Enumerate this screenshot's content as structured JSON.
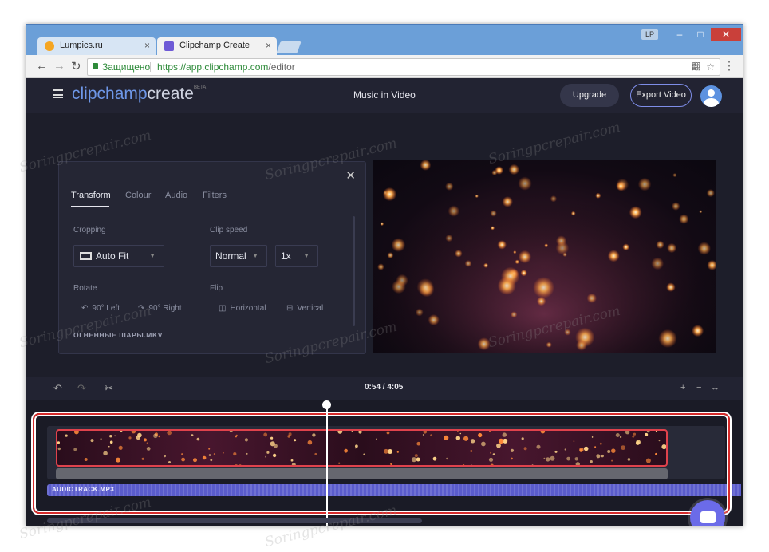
{
  "browser": {
    "tabs": [
      {
        "label": "Lumpics.ru",
        "favicon_color": "#f5a623"
      },
      {
        "label": "Clipchamp Create",
        "favicon_color": "#6e5ad6"
      }
    ],
    "profile_badge": "LP",
    "window_buttons": [
      "–",
      "□",
      "✕"
    ],
    "security_label": "Защищено",
    "url_base": "https://app.clipchamp.com",
    "url_path": "/editor",
    "translate_icon": "翻",
    "star_icon": "☆",
    "menu_icon": "⋮",
    "nav": {
      "back": "←",
      "forward": "→",
      "reload": "↻"
    }
  },
  "header": {
    "logo_part1": "clipchamp",
    "logo_part2": "create",
    "logo_badge": "BETA",
    "project_title": "Music in Video",
    "upgrade_label": "Upgrade",
    "export_label": "Export Video"
  },
  "panel": {
    "close_icon": "✕",
    "tabs": [
      "Transform",
      "Colour",
      "Audio",
      "Filters"
    ],
    "active_tab": "Transform",
    "cropping_label": "Cropping",
    "cropping_value": "Auto Fit",
    "clip_speed_label": "Clip speed",
    "speed_mode": "Normal",
    "speed_value": "1x",
    "rotate_label": "Rotate",
    "rotate_left": "90° Left",
    "rotate_right": "90° Right",
    "flip_label": "Flip",
    "flip_horizontal": "Horizontal",
    "flip_vertical": "Vertical",
    "file_name": "ОГНЕННЫЕ ШАРЫ.MKV",
    "caret": "▼"
  },
  "timeline": {
    "undo_icon": "↶",
    "redo_icon": "↷",
    "split_icon": "✂",
    "timecode": "0:54 / 4:05",
    "zoom_in_icon": "+",
    "zoom_out_icon": "−",
    "fit_icon": "↔",
    "audio_track_label": "AUDIOTRACK.MP3",
    "playhead_position_fraction": 0.22
  },
  "colors": {
    "app_bg": "#1d1e2a",
    "accent": "#6e97e8",
    "export_border": "#7e8de8",
    "clip_border": "#e0424c",
    "audio_track": "#5a5ccc",
    "highlight_frame": "#d62b2b"
  },
  "watermark": "Soringpcrepair.com"
}
